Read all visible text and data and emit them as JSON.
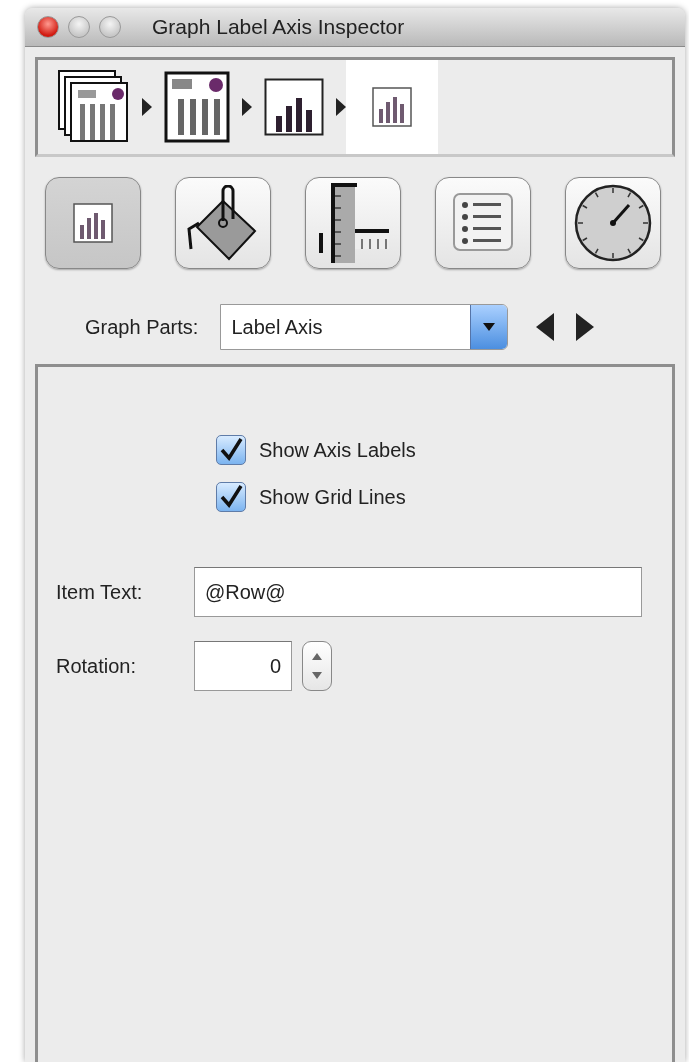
{
  "window": {
    "title": "Graph Label Axis Inspector"
  },
  "breadcrumb": [
    {
      "kind": "report-stack",
      "selected": false
    },
    {
      "kind": "report",
      "selected": false
    },
    {
      "kind": "graph",
      "selected": false
    },
    {
      "kind": "graph-small",
      "selected": true
    }
  ],
  "tools": [
    {
      "kind": "graph",
      "selected": true
    },
    {
      "kind": "paint-bucket",
      "selected": false
    },
    {
      "kind": "ruler",
      "selected": false
    },
    {
      "kind": "list",
      "selected": false
    },
    {
      "kind": "gauge",
      "selected": false
    }
  ],
  "graph_parts": {
    "label": "Graph Parts:",
    "value": "Label Axis"
  },
  "checkboxes": [
    {
      "label": "Show Axis Labels",
      "checked": true
    },
    {
      "label": "Show Grid Lines",
      "checked": true
    }
  ],
  "item_text": {
    "label": "Item Text:",
    "value": "@Row@"
  },
  "rotation": {
    "label": "Rotation:",
    "value": "0"
  }
}
